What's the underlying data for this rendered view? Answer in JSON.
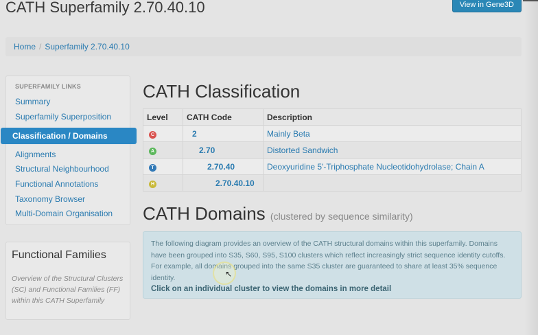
{
  "page": {
    "title": "CATH Superfamily 2.70.40.10",
    "view_button": "View in Gene3D"
  },
  "breadcrumb": {
    "home": "Home",
    "current": "Superfamily 2.70.40.10"
  },
  "sidebar": {
    "heading": "SUPERFAMILY LINKS",
    "items": [
      {
        "label": "Summary"
      },
      {
        "label": "Superfamily Superposition"
      },
      {
        "label": "Classification / Domains",
        "active": true
      },
      {
        "label": "Alignments"
      },
      {
        "label": "Structural Neighbourhood"
      },
      {
        "label": "Functional Annotations"
      },
      {
        "label": "Taxonomy Browser"
      },
      {
        "label": "Multi-Domain Organisation"
      }
    ]
  },
  "functional_families": {
    "title": "Functional Families",
    "description": "Overview of the Structural Clusters (SC) and Functional Families (FF) within this CATH Superfamily"
  },
  "classification": {
    "heading": "CATH Classification",
    "columns": [
      "Level",
      "CATH Code",
      "Description"
    ],
    "rows": [
      {
        "level": "C",
        "level_color": "#d9534f",
        "code": "2",
        "description": "Mainly Beta"
      },
      {
        "level": "A",
        "level_color": "#5cb85c",
        "code": "2.70",
        "description": "Distorted Sandwich"
      },
      {
        "level": "T",
        "level_color": "#337ab7",
        "code": "2.70.40",
        "description": "Deoxyuridine 5'-Triphosphate Nucleotidohydrolase; Chain A"
      },
      {
        "level": "H",
        "level_color": "#c9b93a",
        "code": "2.70.40.10",
        "description": ""
      }
    ]
  },
  "domains": {
    "heading": "CATH Domains",
    "subheading": "(clustered by sequence similarity)",
    "info_text": "The following diagram provides an overview of the CATH structural domains within this superfamily. Domains have been grouped into S35, S60, S95, S100 clusters which reflect increasingly strict sequence identity cutoffs. For example, all domains grouped into the same S35 cluster are guaranteed to share at least 35% sequence identity.",
    "info_cta": "Click on an individual cluster to view the domains in more detail"
  }
}
